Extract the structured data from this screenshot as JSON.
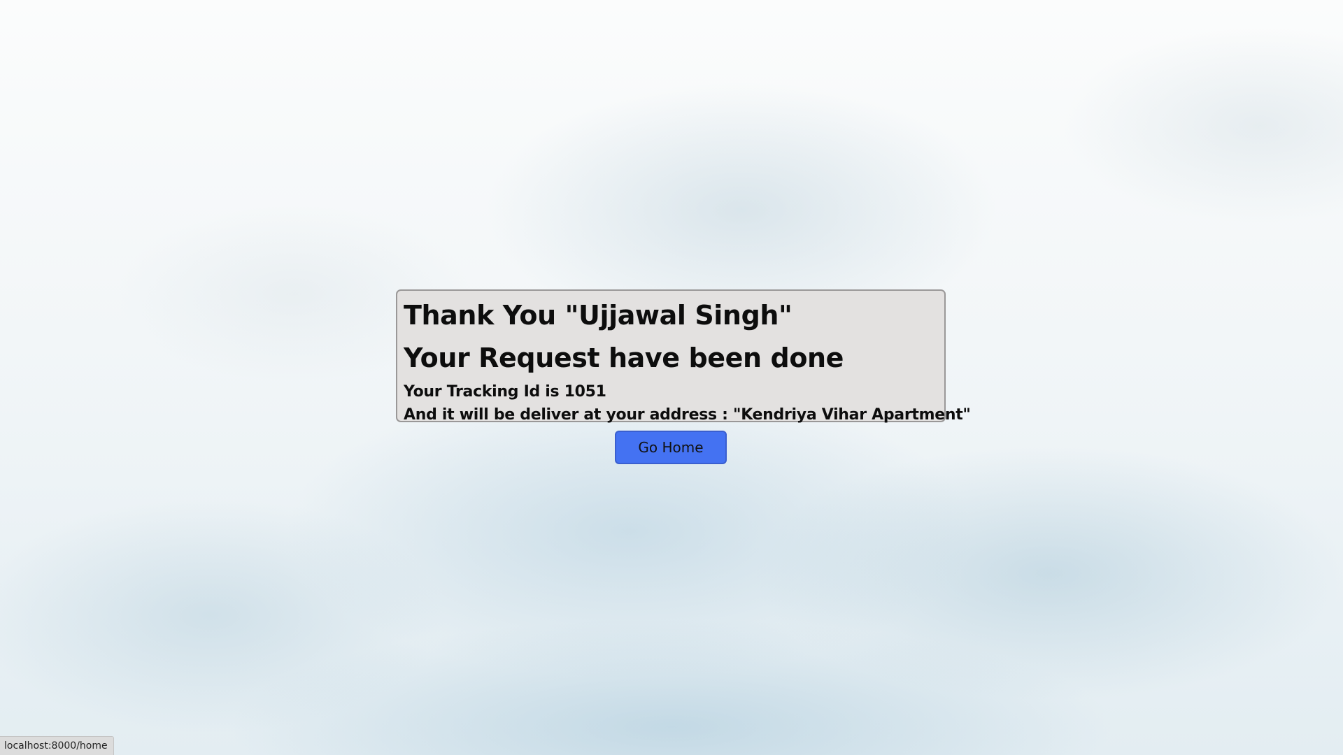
{
  "confirmation": {
    "thank_you": "Thank You \"Ujjawal Singh\"",
    "request_done": "Your Request have been done",
    "tracking": "Your Tracking Id is 1051",
    "address": "And it will be deliver at your address : \"Kendriya Vihar Apartment\""
  },
  "actions": {
    "go_home_label": "Go Home"
  },
  "status_bar": {
    "url": "localhost:8000/home"
  }
}
